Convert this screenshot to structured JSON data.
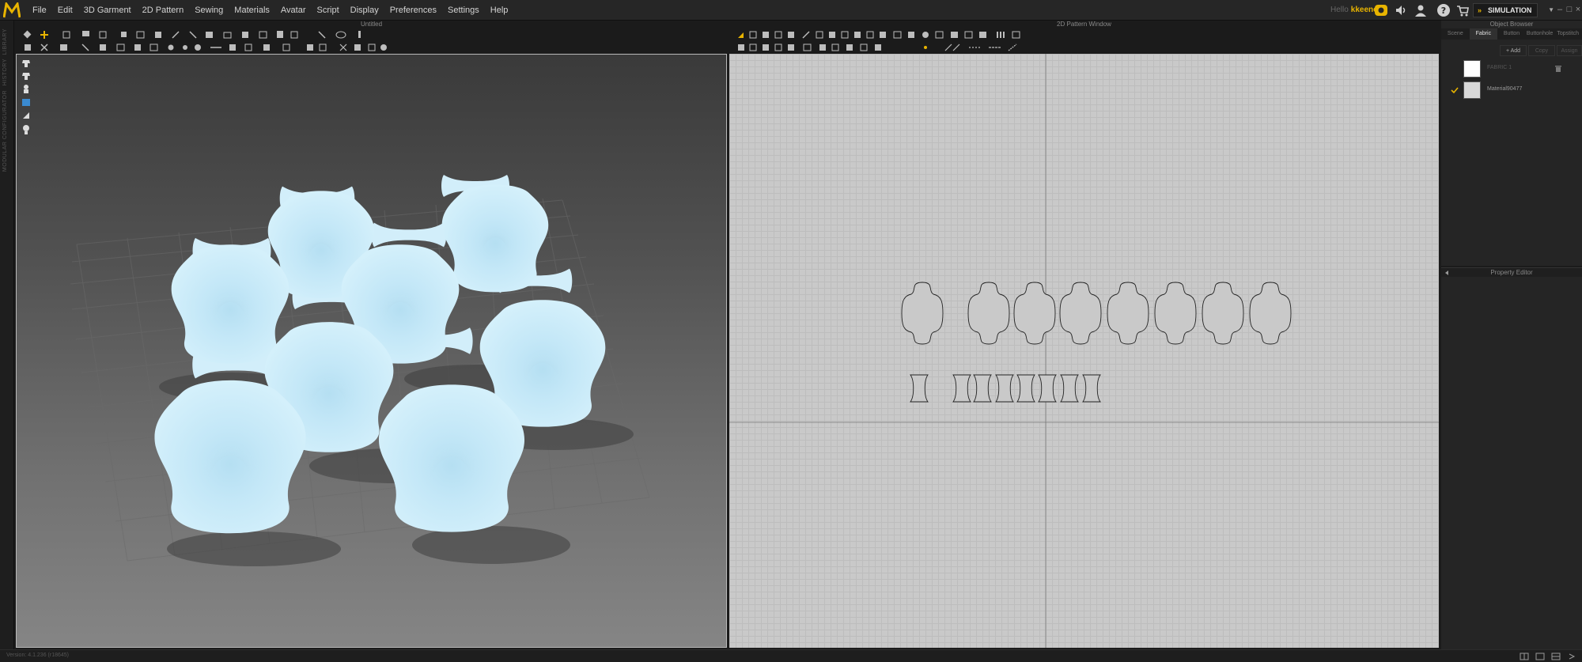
{
  "menubar": {
    "items": [
      "File",
      "Edit",
      "3D Garment",
      "2D Pattern",
      "Sewing",
      "Materials",
      "Avatar",
      "Script",
      "Display",
      "Preferences",
      "Settings",
      "Help"
    ],
    "hello": "Hello",
    "username": "kkeene",
    "mode": "SIMULATION"
  },
  "left_strip": {
    "labels": [
      "LIBRARY",
      "HISTORY",
      "MODULAR CONFIGURATOR"
    ]
  },
  "panels": {
    "viewport3d_title": "Untitled",
    "pattern2d_title": "2D Pattern Window"
  },
  "object_browser": {
    "title": "Object Browser",
    "tabs": [
      "Scene",
      "Fabric",
      "Button",
      "Buttonhole",
      "Topstitch"
    ],
    "active_tab": "Fabric",
    "buttons": [
      "+ Add",
      "Copy",
      "Assign"
    ],
    "fabrics": [
      {
        "name": "FABRIC 1",
        "swatch": "#ffffff",
        "checked": false
      },
      {
        "name": "Material90477",
        "swatch": "#d9d9d9",
        "checked": true
      }
    ]
  },
  "property_editor": {
    "title": "Property Editor"
  },
  "status": {
    "version": "Version: 4.1.236 (r18645)"
  },
  "colors": {
    "accent": "#e8b400",
    "fabric": "#c9e9f7",
    "pattern_bg": "#c9c9c9"
  }
}
